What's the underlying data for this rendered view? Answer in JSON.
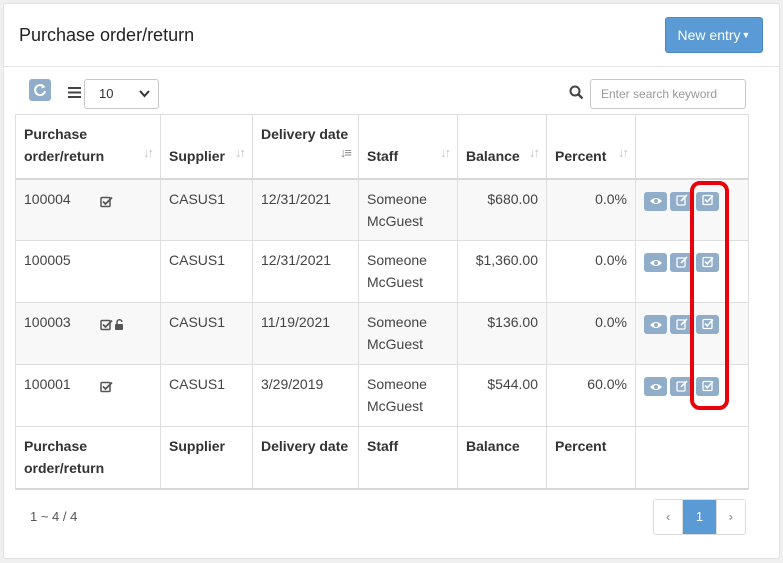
{
  "header": {
    "title": "Purchase order/return",
    "new_entry_label": "New entry"
  },
  "toolbar": {
    "page_size": "10",
    "search_placeholder": "Enter search keyword"
  },
  "table": {
    "columns": [
      "Purchase order/return",
      "Supplier",
      "Delivery date",
      "Staff",
      "Balance",
      "Percent"
    ],
    "rows": [
      {
        "po": "100004",
        "icons": [
          "check-square-icon"
        ],
        "supplier": "CASUS1",
        "delivery": "12/31/2021",
        "staff": "Someone McGuest",
        "balance": "$680.00",
        "percent": "0.0%"
      },
      {
        "po": "100005",
        "icons": [],
        "supplier": "CASUS1",
        "delivery": "12/31/2021",
        "staff": "Someone McGuest",
        "balance": "$1,360.00",
        "percent": "0.0%"
      },
      {
        "po": "100003",
        "icons": [
          "check-square-icon",
          "unlock-icon"
        ],
        "supplier": "CASUS1",
        "delivery": "11/19/2021",
        "staff": "Someone McGuest",
        "balance": "$136.00",
        "percent": "0.0%"
      },
      {
        "po": "100001",
        "icons": [
          "check-square-icon"
        ],
        "supplier": "CASUS1",
        "delivery": "3/29/2019",
        "staff": "Someone McGuest",
        "balance": "$544.00",
        "percent": "60.0%"
      }
    ],
    "row_actions": [
      "view-icon",
      "edit-icon",
      "approve-icon"
    ]
  },
  "footer": {
    "summary": "1 ~ 4 / 4",
    "prev": "‹",
    "current_page": "1",
    "next": "›"
  },
  "colors": {
    "primary": "#5b9bd5",
    "action_button": "#90adc9",
    "highlight": "#e8000a"
  }
}
